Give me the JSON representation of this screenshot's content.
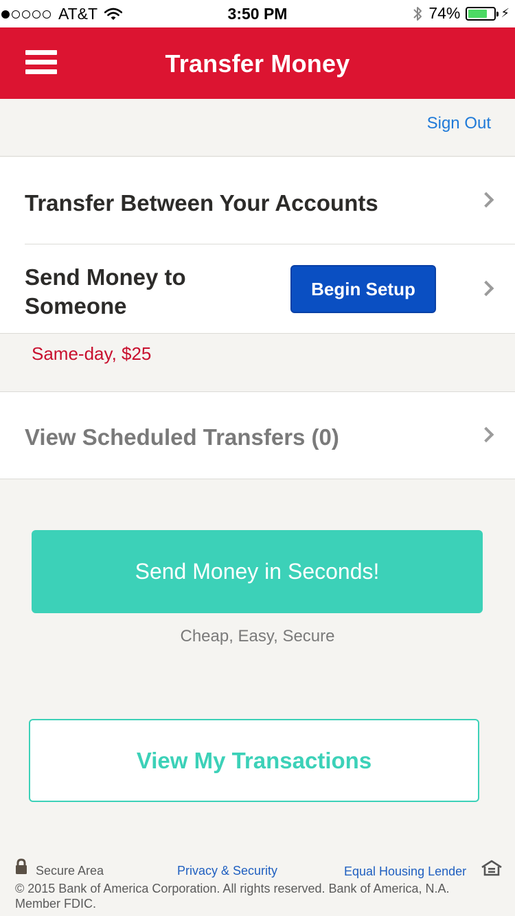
{
  "status_bar": {
    "carrier": "AT&T",
    "time": "3:50 PM",
    "battery_percent": "74%",
    "battery_level": 0.74,
    "signal_bars_filled": 1,
    "signal_bars_total": 5
  },
  "header": {
    "title": "Transfer Money",
    "color": "#dc1431"
  },
  "sign_out": "Sign Out",
  "menu": {
    "transfer_between": "Transfer Between Your Accounts",
    "send_money": "Send Money to Someone",
    "begin_setup": "Begin Setup",
    "promo_note": "Same-day, $25",
    "scheduled": "View Scheduled Transfers (0)"
  },
  "send_money_button": {
    "label": "Send Money in Seconds!",
    "sub": "Cheap, Easy, Secure",
    "color": "#3cd1b8"
  },
  "view_transactions": "View My Transactions",
  "footer": {
    "secure_area": "Secure Area",
    "privacy": "Privacy & Security",
    "equal_housing": "Equal Housing Lender",
    "copyright": "© 2015 Bank of America Corporation. All rights reserved. Bank of America, N.A. Member FDIC."
  }
}
